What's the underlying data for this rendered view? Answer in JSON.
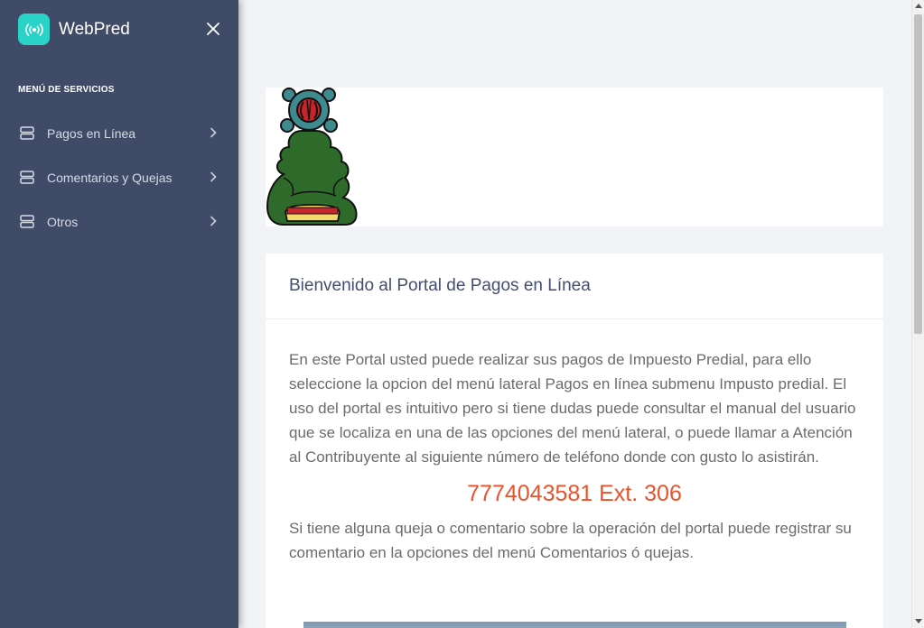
{
  "app": {
    "name": "WebPred"
  },
  "sidebar": {
    "heading": "MENÚ DE SERVICIOS",
    "items": [
      {
        "label": "Pagos en Línea",
        "icon": "server-icon"
      },
      {
        "label": "Comentarios y Quejas",
        "icon": "server-icon"
      },
      {
        "label": "Otros",
        "icon": "server-icon"
      }
    ]
  },
  "content": {
    "title": "Bienvenido al Portal de Pagos en Línea",
    "intro": "En este Portal usted puede realizar sus pagos de Impuesto Predial, para ello seleccione la opcion del menú lateral Pagos en línea submenu Impusto predial. El uso del portal es intuitivo pero si tiene dudas puede consultar el manual del usuario que se localiza en una de las opciones del menú lateral, o puede llamar a Atención al Contribuyente al siguiente número de teléfono donde con gusto lo asistirán.",
    "phone": "7774043581 Ext. 306",
    "complaint": "Si tiene alguna queja o comentario sobre la operación del portal puede registrar su comentario en la opciones del menú Comentarios ó quejas."
  },
  "colors": {
    "sidebar_bg": "#3f4b67",
    "brand_accent": "#2ad3c8",
    "phone": "#e8532b",
    "title": "#434e6e"
  }
}
